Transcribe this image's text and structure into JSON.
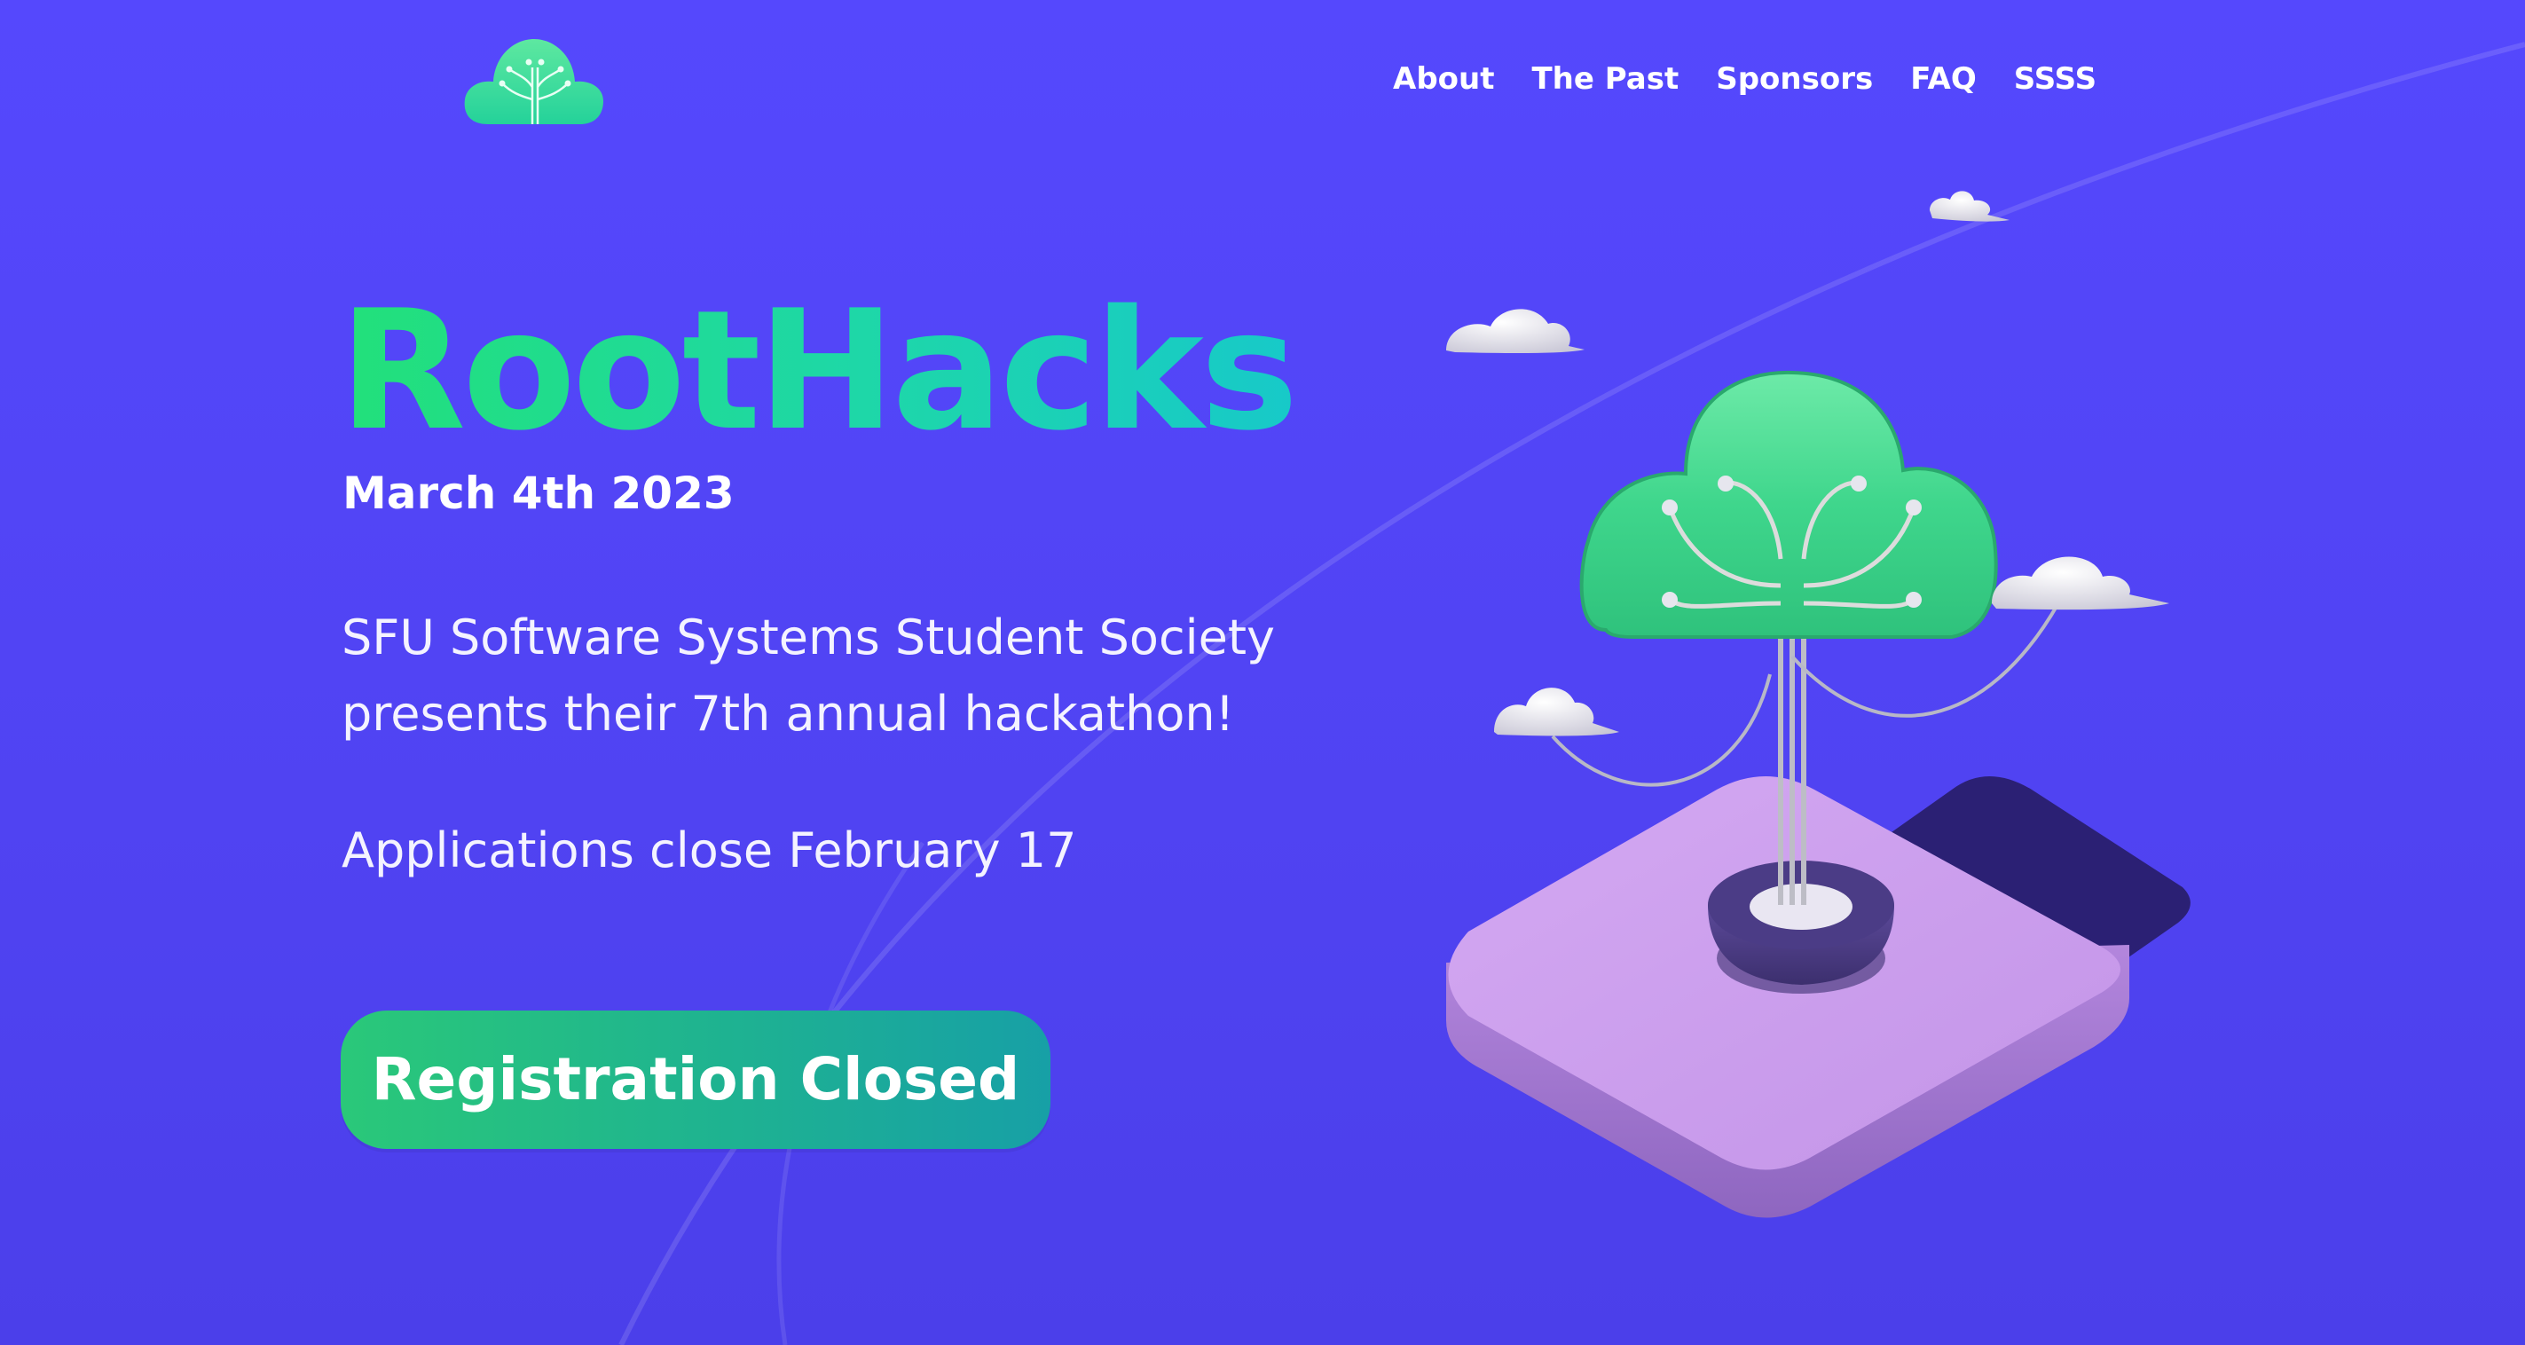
{
  "nav": {
    "items": [
      {
        "label": "About"
      },
      {
        "label": "The Past"
      },
      {
        "label": "Sponsors"
      },
      {
        "label": "FAQ"
      },
      {
        "label": "SSSS"
      }
    ]
  },
  "hero": {
    "title": "RootHacks",
    "date": "March 4th 2023",
    "tagline_line1": "SFU Software Systems Student Society",
    "tagline_line2": "presents their 7th annual hackathon!",
    "deadline": "Applications close February 17",
    "register_label": "Registration Closed"
  },
  "icons": {
    "logo": "cloud-tree-logo-icon",
    "illustration": "cloud-tree-on-platform-illustration",
    "clouds": "cloud-icon"
  },
  "colors": {
    "background": "#5447fb",
    "title_gradient_start": "#22e07a",
    "title_gradient_end": "#17c9c9",
    "button_gradient_start": "#2ac879",
    "button_gradient_end": "#17a0a6",
    "platform": "#c899ec",
    "tree": "#3ed68c",
    "text": "#ffffff"
  }
}
